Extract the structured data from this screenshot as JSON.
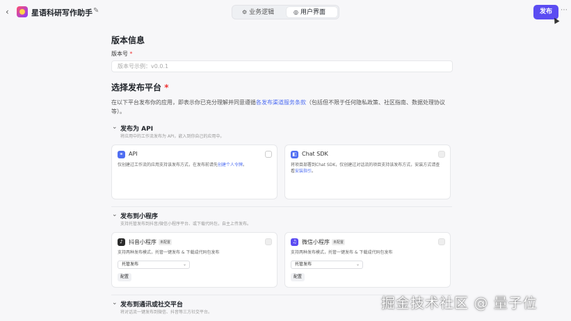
{
  "header": {
    "back_icon": "‹",
    "app_title": "星语科研写作助手",
    "edit_icon": "✎",
    "tabs": [
      {
        "label": "业务逻辑",
        "icon": "⚙"
      },
      {
        "label": "用户界面",
        "icon": "◎"
      }
    ],
    "publish_label": "发布",
    "more_icon": "⋯"
  },
  "version": {
    "section_title": "版本信息",
    "field_label": "版本号",
    "required_mark": "*",
    "placeholder": "版本号示例：v0.0.1"
  },
  "platform": {
    "section_title": "选择发布平台",
    "required_mark": "*",
    "desc_before": "在以下平台发布你的应用，即表示你已充分理解并同意遵循",
    "desc_link": "各发布渠道服务条款",
    "desc_after": "（包括但不限于任何隐私政策、社区指南、数据处理协议等）。"
  },
  "sections": [
    {
      "title": "发布为 API",
      "subtitle": "将应用中的工作流发布为 API，嵌入到你自己的应用中。",
      "cards": [
        {
          "name": "API",
          "icon": "⚭",
          "color": "#4f6ef2",
          "desc_before": "仅创建过工作流的应用支持该发布方式，在发布前请先",
          "desc_link": "创建个人令牌",
          "desc_after": "。",
          "disabled": false
        },
        {
          "name": "Chat SDK",
          "icon": "◧",
          "color": "#4f6ef2",
          "desc_before": "将项目部署到Chat SDK，仅创建过对话流的项目支持该发布方式，安装方式请查看",
          "desc_link": "安装指引",
          "desc_after": "。",
          "disabled": true
        }
      ]
    },
    {
      "title": "发布到小程序",
      "subtitle": "支持托管发布到抖音/微信小程序平台、或下载代码包，自主上传发布。",
      "cards": [
        {
          "name": "抖音小程序",
          "badge": "未配置",
          "icon": "♪",
          "color": "#2b2b2b",
          "desc": "支持两种发布模式，托管一键发布 & 下载成代码包发布",
          "select": "托管发布",
          "config": "配置",
          "disabled": true
        },
        {
          "name": "微信小程序",
          "badge": "未配置",
          "icon": "♫",
          "color": "#5b4cf2",
          "desc": "支持两种发布模式，托管一键发布 & 下载成代码包发布",
          "select": "托管发布",
          "config": "配置",
          "disabled": true
        }
      ]
    },
    {
      "title": "发布到通讯或社交平台",
      "subtitle": "将对话流一键发布到微信、抖音等三方社交平台。"
    }
  ],
  "watermark": "掘金技术社区 @ 量子位"
}
